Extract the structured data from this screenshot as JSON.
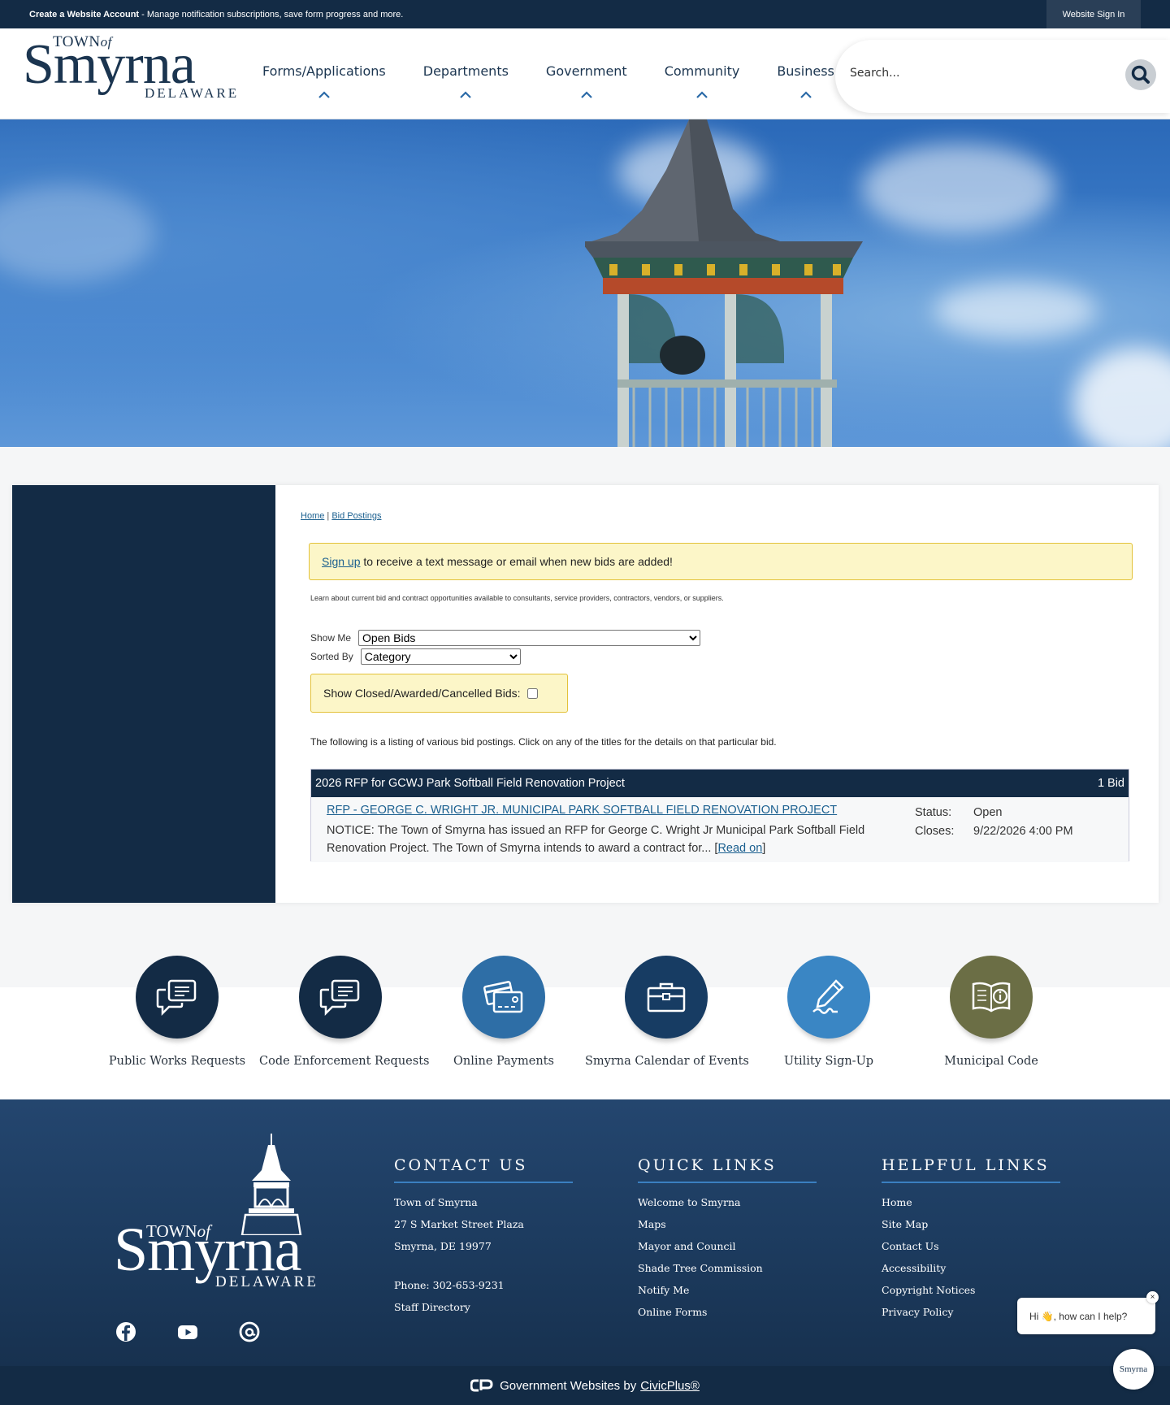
{
  "topbar": {
    "create_account_bold": "Create a Website Account",
    "create_account_rest": " - Manage notification subscriptions, save form progress and more.",
    "sign_in": "Website Sign In"
  },
  "logo": {
    "town_of": "TOWN",
    "of": "of",
    "name": "Smyrna",
    "state": "DELAWARE"
  },
  "nav": {
    "items": [
      {
        "label": "Forms/Applications",
        "icon": "chevron-up-icon"
      },
      {
        "label": "Departments",
        "icon": "chevron-up-icon"
      },
      {
        "label": "Government",
        "icon": "chevron-up-icon"
      },
      {
        "label": "Community",
        "icon": "chevron-up-icon"
      },
      {
        "label": "Business",
        "icon": "chevron-up-icon"
      }
    ]
  },
  "search": {
    "placeholder": "Search...",
    "icon": "search-icon"
  },
  "breadcrumb": {
    "home": "Home",
    "separator": "|",
    "current": "Bid Postings"
  },
  "alert": {
    "link": "Sign up",
    "text": " to receive a text message or email when new bids are added!"
  },
  "intro": "Learn about current bid and contract opportunities available to consultants, service providers, contractors, vendors, or suppliers.",
  "filters": {
    "show_me_label": "Show Me",
    "show_me_value": "Open Bids",
    "sorted_by_label": "Sorted By",
    "sorted_by_value": "Category",
    "closed_label": "Show Closed/Awarded/Cancelled Bids:",
    "closed_checked": false
  },
  "listing_note": "The following is a listing of various bid postings. Click on any of the titles for the details on that particular bid.",
  "bid_category": {
    "title": "2026 RFP for GCWJ Park Softball Field Renovation Project",
    "count": "1 Bid",
    "bids": [
      {
        "title": "RFP - GEORGE C. WRIGHT JR. MUNICIPAL PARK SOFTBALL FIELD RENOVATION PROJECT",
        "description": "NOTICE: The Town of Smyrna has issued an RFP for George C. Wright Jr Municipal Park Softball Field Renovation Project. The Town of Smyrna intends to award a contract for... ",
        "read_on": "Read on",
        "status_label": "Status:",
        "status": "Open",
        "closes_label": "Closes:",
        "closes": "9/22/2026 4:00 PM"
      }
    ]
  },
  "quick_links": [
    {
      "label": "Public Works Requests",
      "icon": "chat-bubbles-icon",
      "color": "#132b45"
    },
    {
      "label": "Code Enforcement Requests",
      "icon": "chat-bubbles-icon",
      "color": "#132b45"
    },
    {
      "label": "Online Payments",
      "icon": "credit-card-icon",
      "color": "#2e6ea6"
    },
    {
      "label": "Smyrna Calendar of Events",
      "icon": "briefcase-icon",
      "color": "#173c63"
    },
    {
      "label": "Utility Sign-Up",
      "icon": "pen-signature-icon",
      "color": "#3a86c4"
    },
    {
      "label": "Municipal Code",
      "icon": "info-book-icon",
      "color": "#6b6e45"
    }
  ],
  "footer": {
    "contact": {
      "heading": "CONTACT US",
      "org": "Town of Smyrna",
      "address1": "27 S Market Street Plaza",
      "address2": "Smyrna, DE 19977",
      "phone": "Phone: 302-653-9231",
      "staff_directory": "Staff Directory"
    },
    "quick_links": {
      "heading": "QUICK LINKS",
      "items": [
        "Welcome to Smyrna",
        "Maps",
        "Mayor and Council",
        "Shade Tree Commission",
        "Notify Me",
        "Online Forms"
      ]
    },
    "helpful_links": {
      "heading": "HELPFUL LINKS",
      "items": [
        "Home",
        "Site Map",
        "Contact Us",
        "Accessibility",
        "Copyright Notices",
        "Privacy Policy"
      ]
    },
    "social": [
      "facebook-icon",
      "youtube-icon",
      "threads-icon"
    ]
  },
  "bottombar": {
    "text": "Government Websites by",
    "link": "CivicPlus®"
  },
  "chat": {
    "greeting": "Hi 👋, how can I help?",
    "close": "×",
    "avatar_text": "Smyrna"
  },
  "colors": {
    "navy": "#132b45",
    "accent_blue": "#3a7fc0",
    "alert_yellow": "#fcf6c8"
  }
}
